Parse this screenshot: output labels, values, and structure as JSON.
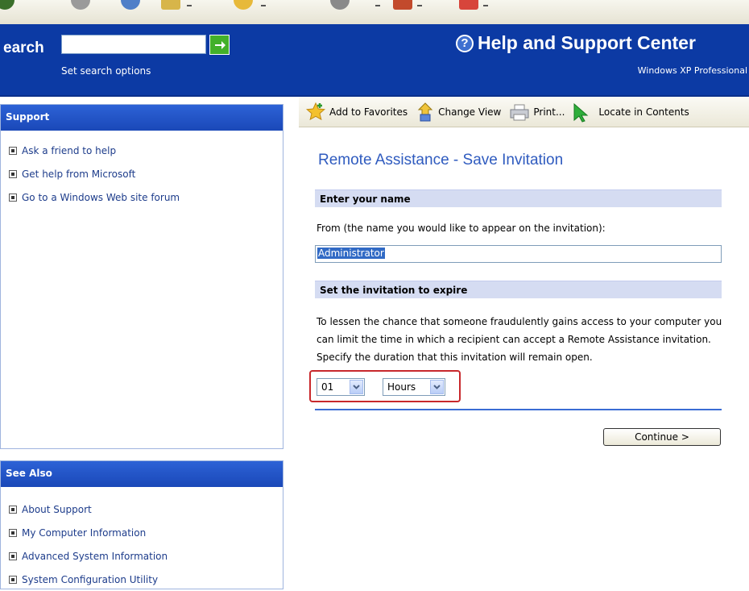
{
  "header": {
    "search_label": "earch",
    "search_value": "",
    "search_options": "Set search options",
    "title": "Help and Support Center",
    "edition": "Windows XP Professional"
  },
  "support_pane": {
    "title": "Support",
    "items": [
      {
        "label": "Ask a friend to help"
      },
      {
        "label": "Get help from Microsoft"
      },
      {
        "label": "Go to a Windows Web site forum"
      }
    ]
  },
  "see_also_pane": {
    "title": "See Also",
    "items": [
      {
        "label": "About Support"
      },
      {
        "label": "My Computer Information"
      },
      {
        "label": "Advanced System Information"
      },
      {
        "label": "System Configuration Utility"
      }
    ]
  },
  "toolbar": {
    "add_favorites": "Add to Favorites",
    "change_view": "Change View",
    "print": "Print...",
    "locate": "Locate in Contents"
  },
  "content": {
    "title": "Remote Assistance - Save Invitation",
    "section_name": "Enter your name",
    "from_label": "From (the name you would like to appear on the invitation):",
    "name_value": "Administrator",
    "section_expire": "Set the invitation to expire",
    "expire_text": "To lessen the chance that someone fraudulently gains access to your computer you can limit the time in which a recipient can accept a Remote Assistance invitation. Specify the duration that this invitation will remain open.",
    "duration_value": "01",
    "duration_unit": "Hours",
    "continue_label": "Continue >"
  },
  "colors": {
    "header_blue": "#0c3aa4",
    "pane_head": "#1a48b8",
    "title_blue": "#2f5bbf",
    "section_bar": "#d5dcf2",
    "highlight_red": "#c8282c"
  }
}
